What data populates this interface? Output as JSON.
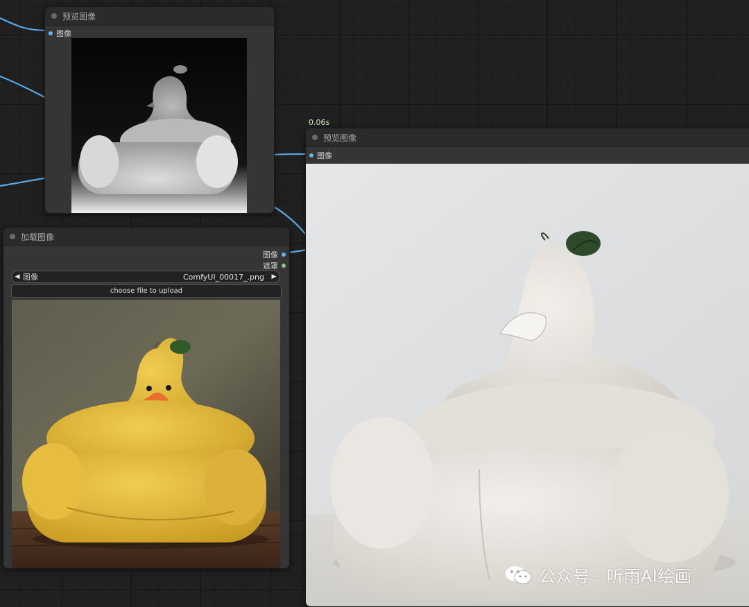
{
  "preview_node_1": {
    "title": "预览图像",
    "input_label": "图像"
  },
  "preview_node_2": {
    "title": "预览图像",
    "input_label": "图像",
    "timing": "0.06s"
  },
  "load_node": {
    "title": "加载图像",
    "output_image": "图像",
    "output_mask": "遮罩",
    "widget_label": "图像",
    "widget_value": "ComfyUI_00017_.png",
    "upload_label": "choose file to upload"
  },
  "watermark": {
    "text": "公众号 · 听雨AI绘画"
  },
  "icons": {
    "prev": "left-triangle-icon",
    "next": "right-triangle-icon",
    "wechat": "wechat-logo-icon"
  },
  "colors": {
    "link": "#5aa7e8",
    "slot_image": "#64b5f6",
    "slot_mask": "#7fcf7f",
    "node_bg": "#353535",
    "canvas_bg": "#202020"
  }
}
